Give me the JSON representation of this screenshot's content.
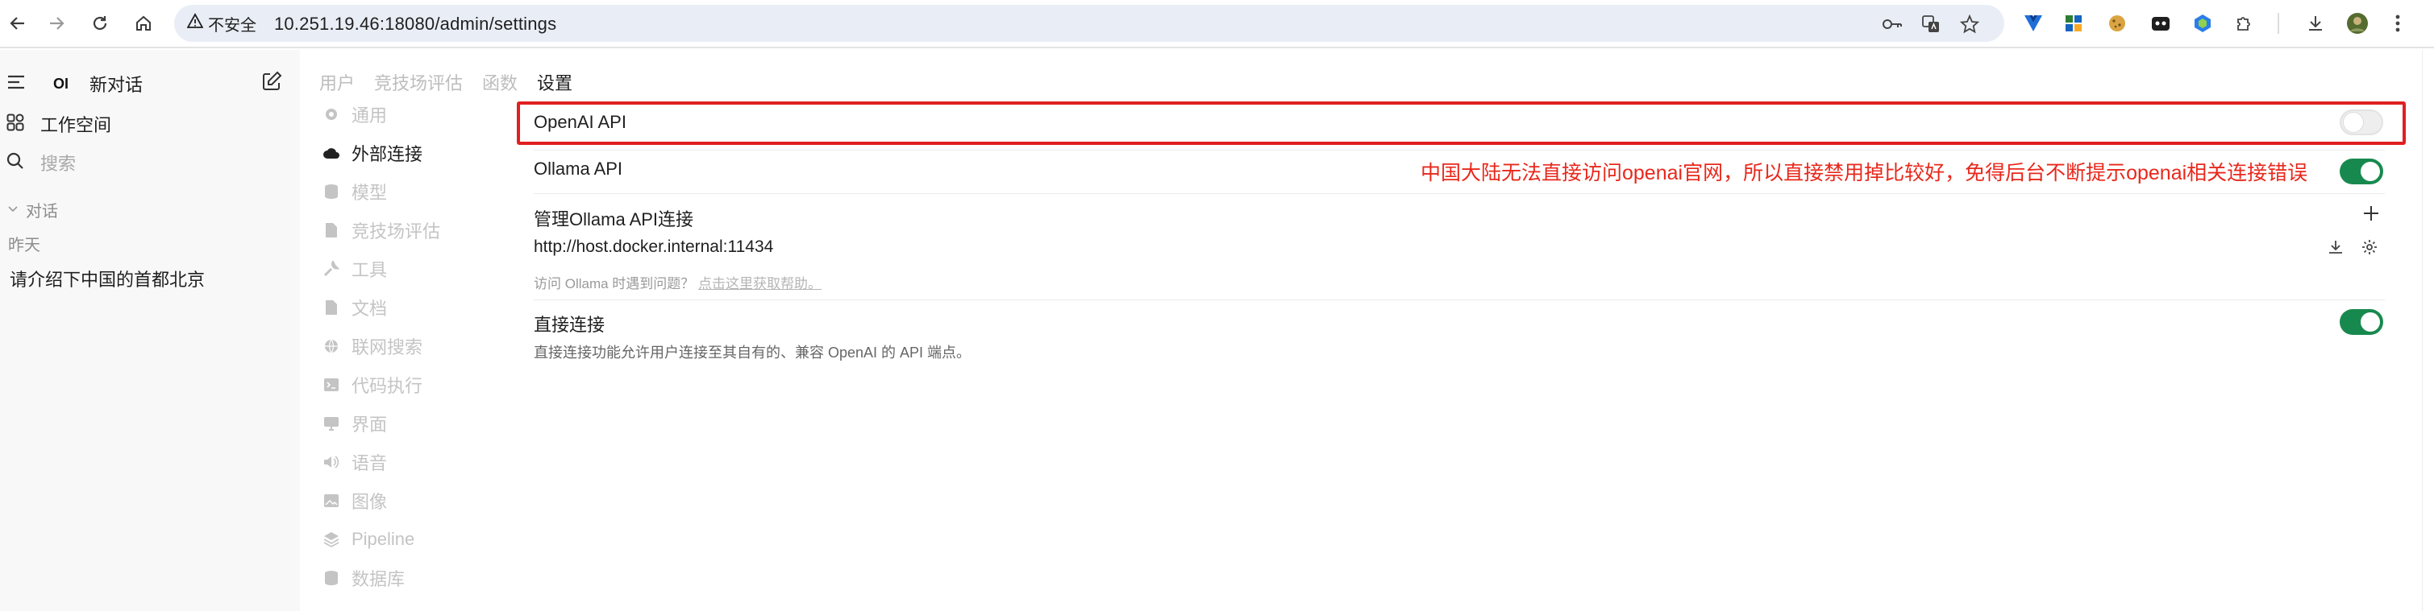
{
  "browser": {
    "security_label": "不安全",
    "url": "10.251.19.46:18080/admin/settings"
  },
  "sidebar": {
    "new_chat": "新对话",
    "logo_text": "OI",
    "workspace": "工作空间",
    "search_placeholder": "搜索",
    "section_chats": "对话",
    "group_yesterday": "昨天",
    "chat_items": [
      "请介绍下中国的首都北京"
    ]
  },
  "admin_tabs": {
    "users": "用户",
    "arena": "竞技场评估",
    "functions": "函数",
    "settings": "设置"
  },
  "settings_nav": [
    {
      "label": "通用",
      "icon": "gear-icon"
    },
    {
      "label": "外部连接",
      "icon": "cloud-icon"
    },
    {
      "label": "模型",
      "icon": "database-icon"
    },
    {
      "label": "竞技场评估",
      "icon": "document-icon"
    },
    {
      "label": "工具",
      "icon": "wrench-icon"
    },
    {
      "label": "文档",
      "icon": "document-icon"
    },
    {
      "label": "联网搜索",
      "icon": "globe-icon"
    },
    {
      "label": "代码执行",
      "icon": "terminal-icon"
    },
    {
      "label": "界面",
      "icon": "monitor-icon"
    },
    {
      "label": "语音",
      "icon": "speaker-icon"
    },
    {
      "label": "图像",
      "icon": "image-icon"
    },
    {
      "label": "Pipeline",
      "icon": "layers-icon"
    },
    {
      "label": "数据库",
      "icon": "database-icon"
    }
  ],
  "connections": {
    "openai_label": "OpenAI API",
    "openai_enabled": false,
    "ollama_label": "Ollama API",
    "ollama_enabled": true,
    "annotation": "中国大陆无法直接访问openai官网，所以直接禁用掉比较好，免得后台不断提示openai相关连接错误",
    "manage_ollama_label": "管理Ollama API连接",
    "ollama_url": "http://host.docker.internal:11434",
    "ollama_help_prefix": "访问 Ollama 时遇到问题？",
    "ollama_help_link": "点击这里获取帮助。",
    "direct_label": "直接连接",
    "direct_enabled": true,
    "direct_desc": "直接连接功能允许用户连接至其自有的、兼容 OpenAI 的 API 端点。"
  },
  "colors": {
    "accent_green": "#18894e",
    "annotation_red": "#e8281c"
  }
}
